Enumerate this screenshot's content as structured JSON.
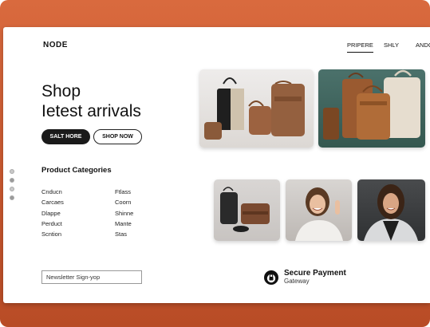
{
  "header": {
    "logo": "NODE",
    "nav": [
      "PRIPERE",
      "SHLY",
      "ANDO"
    ]
  },
  "hero": {
    "title_line1": "Shop",
    "title_line2": "Ietest arrivals",
    "primary_button": "SALT HORE",
    "secondary_button": "SHOP NOW"
  },
  "categories": {
    "heading": "Product Categories",
    "col1": [
      "Cnducn",
      "Carcaes",
      "Dlappe",
      "Perduct",
      "Scntion"
    ],
    "col2": [
      "Ftlass",
      "Coorn",
      "Shinne",
      "Mante",
      "Stas"
    ]
  },
  "newsletter": {
    "placeholder": "Newsletter Sign-yop"
  },
  "secure": {
    "title": "Secure Payment",
    "subtitle": "Gateway"
  },
  "colors": {
    "frame": "#c85a30",
    "dark": "#1a1a1a",
    "teal_bg": "#3f6661"
  }
}
